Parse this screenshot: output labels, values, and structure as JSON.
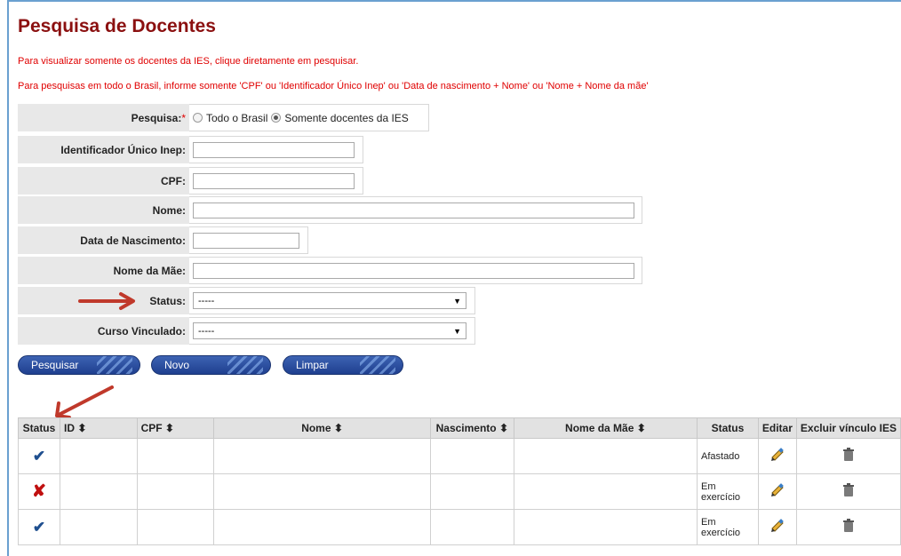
{
  "page": {
    "title": "Pesquisa de Docentes",
    "note1": "Para visualizar somente os docentes da IES, clique diretamente em pesquisar.",
    "note2": "Para pesquisas em todo o Brasil, informe somente 'CPF' ou 'Identificador Único Inep' ou 'Data de nascimento + Nome' ou 'Nome + Nome da mãe'"
  },
  "form": {
    "pesquisa_label": "Pesquisa:",
    "pesquisa_req": "*",
    "radio_todo": "Todo o Brasil",
    "radio_ies": "Somente docentes da IES",
    "inep_label": "Identificador Único Inep:",
    "inep_value": "",
    "cpf_label": "CPF:",
    "cpf_value": "",
    "nome_label": "Nome:",
    "nome_value": "",
    "nasc_label": "Data de Nascimento:",
    "nasc_value": "",
    "mae_label": "Nome da Mãe:",
    "mae_value": "",
    "status_label": "Status:",
    "status_selected": "-----",
    "curso_label": "Curso Vinculado:",
    "curso_selected": "-----"
  },
  "buttons": {
    "pesquisar": "Pesquisar",
    "novo": "Novo",
    "limpar": "Limpar"
  },
  "table": {
    "headers": {
      "status": "Status",
      "id": "ID ⬍",
      "cpf": "CPF ⬍",
      "nome": "Nome ⬍",
      "nascimento": "Nascimento ⬍",
      "mae": "Nome da Mãe ⬍",
      "status2": "Status",
      "editar": "Editar",
      "excluir": "Excluir vínculo IES"
    },
    "rows": [
      {
        "status_icon": "check-icon",
        "situacao": "Afastado"
      },
      {
        "status_icon": "cross-icon",
        "situacao": "Em exercício"
      },
      {
        "status_icon": "check-icon",
        "situacao": "Em exercício"
      }
    ]
  },
  "colors": {
    "title": "#8b1010",
    "notes": "#e00000",
    "button": "#2a4d9f",
    "arrow": "#c0392b"
  }
}
